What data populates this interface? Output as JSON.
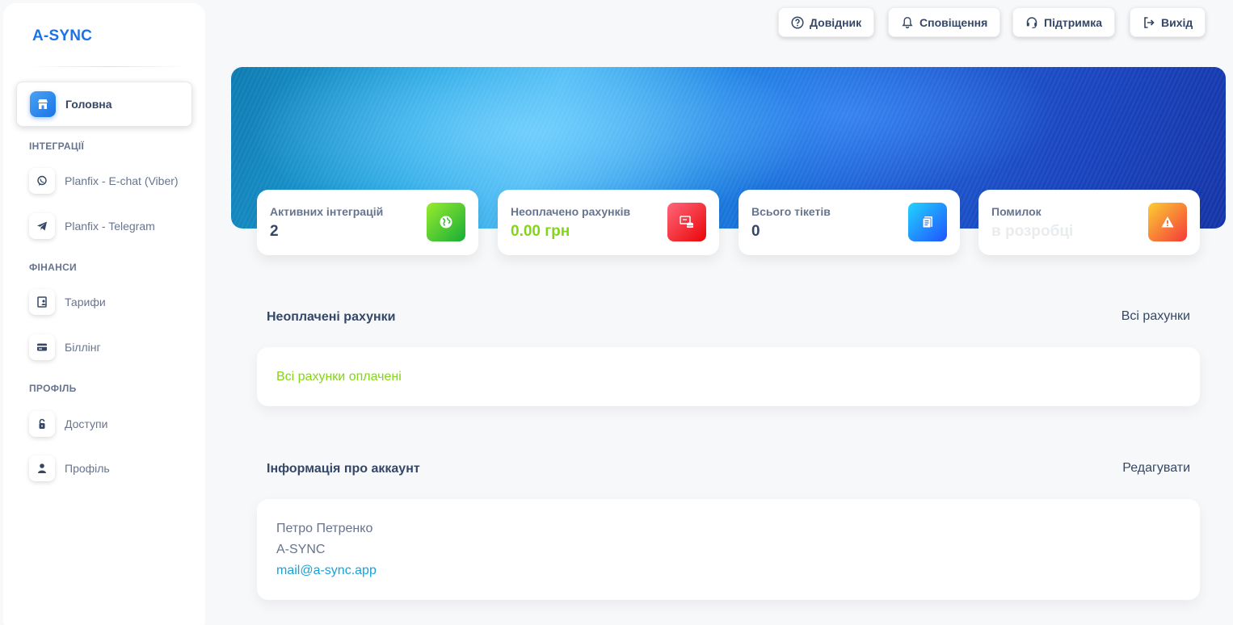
{
  "app": {
    "logo": "A-SYNC"
  },
  "sidebar": {
    "home": {
      "label": "Головна",
      "icon": "store-icon"
    },
    "sections": [
      {
        "title": "ІНТЕГРАЦІЇ",
        "items": [
          {
            "label": "Planfix - E-chat (Viber)",
            "icon": "viber-icon"
          },
          {
            "label": "Planfix - Telegram",
            "icon": "telegram-icon"
          }
        ]
      },
      {
        "title": "ФІНАНСИ",
        "items": [
          {
            "label": "Тарифи",
            "icon": "tariff-icon"
          },
          {
            "label": "Біллінг",
            "icon": "credit-card-icon"
          }
        ]
      },
      {
        "title": "ПРОФІЛЬ",
        "items": [
          {
            "label": "Доступи",
            "icon": "lock-icon"
          },
          {
            "label": "Профіль",
            "icon": "user-icon"
          }
        ]
      }
    ]
  },
  "topbar": {
    "help": "Довідник",
    "notifications": "Сповіщення",
    "support": "Підтримка",
    "logout": "Вихід"
  },
  "stats": [
    {
      "label": "Активних інтеграцій",
      "value": "2",
      "icon": "globe-icon",
      "color": "#82d616"
    },
    {
      "label": "Неоплачено рахунків",
      "value": "0.00 грн",
      "icon": "invoice-icon",
      "color": "#ea0606"
    },
    {
      "label": "Всього тікетів",
      "value": "0",
      "icon": "document-icon",
      "color": "#1a73e8"
    },
    {
      "label": "Помилок",
      "value": "в розробці",
      "icon": "warning-icon",
      "color": "#f53939"
    }
  ],
  "unpaid": {
    "title": "Неоплачені рахунки",
    "link": "Всі рахунки",
    "message": "Всі рахунки оплачені"
  },
  "account": {
    "title": "Інформація про аккаунт",
    "link": "Редагувати",
    "name": "Петро Петренко",
    "company": "A-SYNC",
    "email": "mail@a-sync.app"
  }
}
